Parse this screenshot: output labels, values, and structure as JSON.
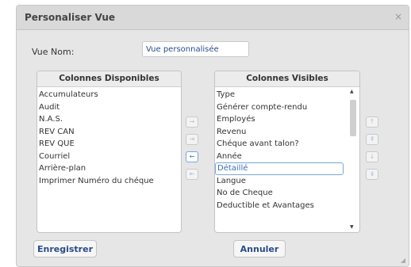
{
  "dialog": {
    "title": "Personaliser Vue",
    "close_icon": "×",
    "view_name_label": "Vue Nom:",
    "view_name_value": "Vue personnalisée"
  },
  "available": {
    "header": "Colonnes Disponibles",
    "items": [
      "Accumulateurs",
      "Audit",
      "N.A.S.",
      "REV CAN",
      "REV QUE",
      "Courriel",
      "Arrière-plan",
      "Imprimer Numéro du chéque"
    ]
  },
  "visible": {
    "header": "Colonnes Visibles",
    "selected_index": 6,
    "items": [
      "Type",
      "Générer compte-rendu",
      "Employés",
      "Revenu",
      "Chéque avant talon?",
      "Année",
      "Détaillé",
      "Langue",
      "No de Cheque",
      "Deductible et Avantages"
    ]
  },
  "move_buttons": {
    "move_right": "→",
    "move_all_right": "⇥",
    "move_left": "←",
    "move_all_left": "⇤"
  },
  "order_buttons": {
    "up": "↑",
    "top": "⇞",
    "down": "↓",
    "bottom": "⇟"
  },
  "scroll": {
    "up": "▲",
    "down": "▼"
  },
  "buttons": {
    "save": "Enregistrer",
    "cancel": "Annuler"
  },
  "resize_icon": "◢"
}
